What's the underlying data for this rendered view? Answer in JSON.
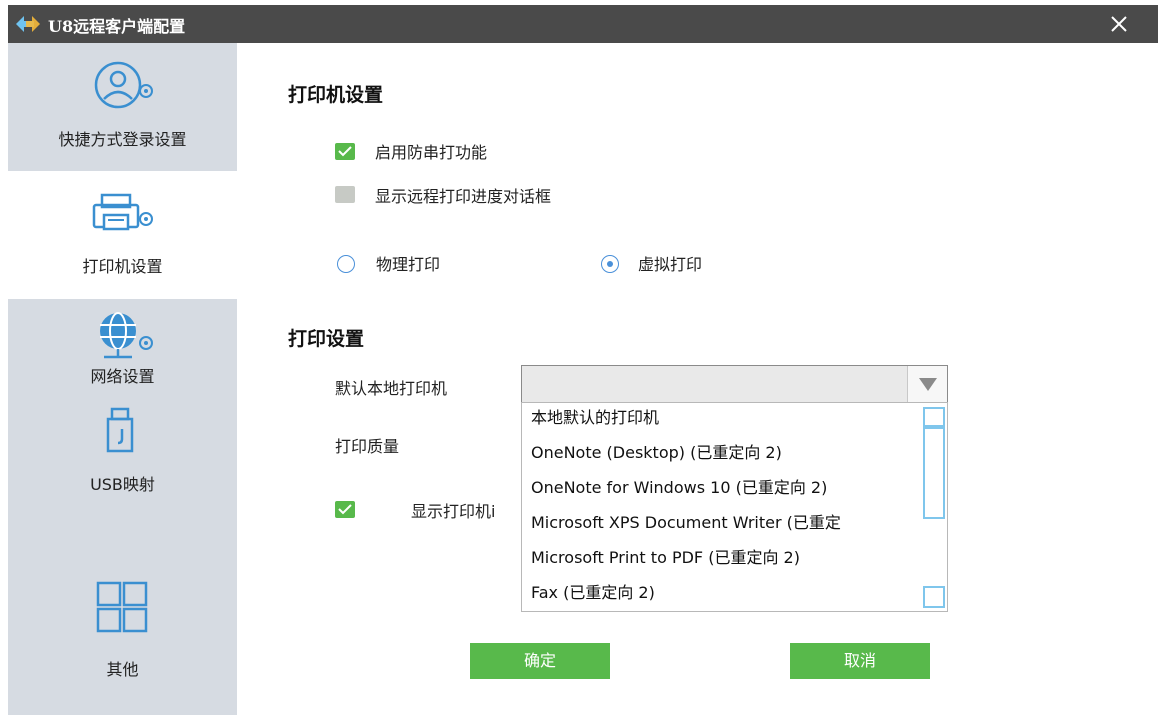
{
  "window": {
    "title": "U8远程客户端配置"
  },
  "sidebar": {
    "items": [
      {
        "label": "快捷方式登录设置",
        "icon": "user-gear-icon"
      },
      {
        "label": "打印机设置",
        "icon": "printer-gear-icon"
      },
      {
        "label": "网络设置",
        "icon": "globe-gear-icon"
      },
      {
        "label": "USB映射",
        "icon": "usb-icon"
      },
      {
        "label": "其他",
        "icon": "grid-icon"
      }
    ],
    "active": 1
  },
  "printer_settings": {
    "title": "打印机设置",
    "enable_anti_serial": {
      "label": "启用防串打功能",
      "checked": true
    },
    "show_progress": {
      "label": "显示远程打印进度对话框",
      "checked": false
    },
    "mode_physical": {
      "label": "物理打印",
      "selected": false
    },
    "mode_virtual": {
      "label": "虚拟打印",
      "selected": true
    }
  },
  "print_settings": {
    "title": "打印设置",
    "default_printer_label": "默认本地打印机",
    "default_printer_value": "",
    "quality_label": "打印质量",
    "show_printer_label": "显示打印机i",
    "show_printer_checked": true,
    "dropdown_options": [
      "本地默认的打印机",
      "OneNote (Desktop) (已重定向 2)",
      "OneNote for Windows 10 (已重定向 2)",
      "Microsoft XPS Document Writer (已重定",
      "Microsoft Print to PDF (已重定向 2)",
      "Fax (已重定向 2)"
    ]
  },
  "buttons": {
    "ok": "确定",
    "cancel": "取消"
  },
  "colors": {
    "accent": "#58b94b",
    "titlebar": "#4a4a4a",
    "sidebar": "#d6dbe2",
    "radio": "#4a90d9",
    "scrollbar": "#7fc6ec"
  }
}
